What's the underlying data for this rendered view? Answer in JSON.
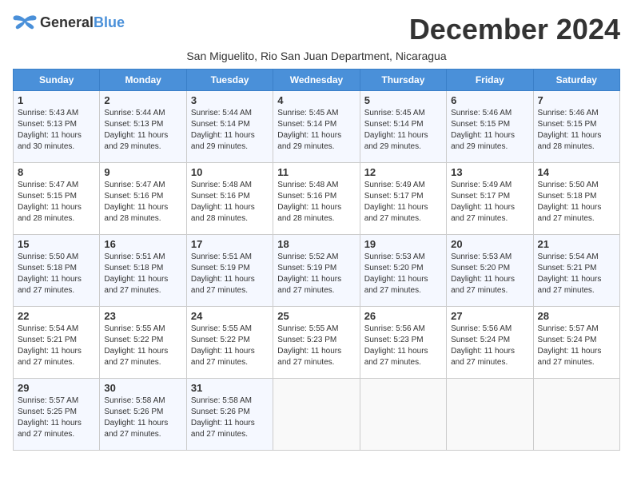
{
  "logo": {
    "general": "General",
    "blue": "Blue"
  },
  "title": "December 2024",
  "subtitle": "San Miguelito, Rio San Juan Department, Nicaragua",
  "days_of_week": [
    "Sunday",
    "Monday",
    "Tuesday",
    "Wednesday",
    "Thursday",
    "Friday",
    "Saturday"
  ],
  "weeks": [
    [
      {
        "day": "1",
        "info": "Sunrise: 5:43 AM\nSunset: 5:13 PM\nDaylight: 11 hours\nand 30 minutes."
      },
      {
        "day": "2",
        "info": "Sunrise: 5:44 AM\nSunset: 5:13 PM\nDaylight: 11 hours\nand 29 minutes."
      },
      {
        "day": "3",
        "info": "Sunrise: 5:44 AM\nSunset: 5:14 PM\nDaylight: 11 hours\nand 29 minutes."
      },
      {
        "day": "4",
        "info": "Sunrise: 5:45 AM\nSunset: 5:14 PM\nDaylight: 11 hours\nand 29 minutes."
      },
      {
        "day": "5",
        "info": "Sunrise: 5:45 AM\nSunset: 5:14 PM\nDaylight: 11 hours\nand 29 minutes."
      },
      {
        "day": "6",
        "info": "Sunrise: 5:46 AM\nSunset: 5:15 PM\nDaylight: 11 hours\nand 29 minutes."
      },
      {
        "day": "7",
        "info": "Sunrise: 5:46 AM\nSunset: 5:15 PM\nDaylight: 11 hours\nand 28 minutes."
      }
    ],
    [
      {
        "day": "8",
        "info": "Sunrise: 5:47 AM\nSunset: 5:15 PM\nDaylight: 11 hours\nand 28 minutes."
      },
      {
        "day": "9",
        "info": "Sunrise: 5:47 AM\nSunset: 5:16 PM\nDaylight: 11 hours\nand 28 minutes."
      },
      {
        "day": "10",
        "info": "Sunrise: 5:48 AM\nSunset: 5:16 PM\nDaylight: 11 hours\nand 28 minutes."
      },
      {
        "day": "11",
        "info": "Sunrise: 5:48 AM\nSunset: 5:16 PM\nDaylight: 11 hours\nand 28 minutes."
      },
      {
        "day": "12",
        "info": "Sunrise: 5:49 AM\nSunset: 5:17 PM\nDaylight: 11 hours\nand 27 minutes."
      },
      {
        "day": "13",
        "info": "Sunrise: 5:49 AM\nSunset: 5:17 PM\nDaylight: 11 hours\nand 27 minutes."
      },
      {
        "day": "14",
        "info": "Sunrise: 5:50 AM\nSunset: 5:18 PM\nDaylight: 11 hours\nand 27 minutes."
      }
    ],
    [
      {
        "day": "15",
        "info": "Sunrise: 5:50 AM\nSunset: 5:18 PM\nDaylight: 11 hours\nand 27 minutes."
      },
      {
        "day": "16",
        "info": "Sunrise: 5:51 AM\nSunset: 5:18 PM\nDaylight: 11 hours\nand 27 minutes."
      },
      {
        "day": "17",
        "info": "Sunrise: 5:51 AM\nSunset: 5:19 PM\nDaylight: 11 hours\nand 27 minutes."
      },
      {
        "day": "18",
        "info": "Sunrise: 5:52 AM\nSunset: 5:19 PM\nDaylight: 11 hours\nand 27 minutes."
      },
      {
        "day": "19",
        "info": "Sunrise: 5:53 AM\nSunset: 5:20 PM\nDaylight: 11 hours\nand 27 minutes."
      },
      {
        "day": "20",
        "info": "Sunrise: 5:53 AM\nSunset: 5:20 PM\nDaylight: 11 hours\nand 27 minutes."
      },
      {
        "day": "21",
        "info": "Sunrise: 5:54 AM\nSunset: 5:21 PM\nDaylight: 11 hours\nand 27 minutes."
      }
    ],
    [
      {
        "day": "22",
        "info": "Sunrise: 5:54 AM\nSunset: 5:21 PM\nDaylight: 11 hours\nand 27 minutes."
      },
      {
        "day": "23",
        "info": "Sunrise: 5:55 AM\nSunset: 5:22 PM\nDaylight: 11 hours\nand 27 minutes."
      },
      {
        "day": "24",
        "info": "Sunrise: 5:55 AM\nSunset: 5:22 PM\nDaylight: 11 hours\nand 27 minutes."
      },
      {
        "day": "25",
        "info": "Sunrise: 5:55 AM\nSunset: 5:23 PM\nDaylight: 11 hours\nand 27 minutes."
      },
      {
        "day": "26",
        "info": "Sunrise: 5:56 AM\nSunset: 5:23 PM\nDaylight: 11 hours\nand 27 minutes."
      },
      {
        "day": "27",
        "info": "Sunrise: 5:56 AM\nSunset: 5:24 PM\nDaylight: 11 hours\nand 27 minutes."
      },
      {
        "day": "28",
        "info": "Sunrise: 5:57 AM\nSunset: 5:24 PM\nDaylight: 11 hours\nand 27 minutes."
      }
    ],
    [
      {
        "day": "29",
        "info": "Sunrise: 5:57 AM\nSunset: 5:25 PM\nDaylight: 11 hours\nand 27 minutes."
      },
      {
        "day": "30",
        "info": "Sunrise: 5:58 AM\nSunset: 5:26 PM\nDaylight: 11 hours\nand 27 minutes."
      },
      {
        "day": "31",
        "info": "Sunrise: 5:58 AM\nSunset: 5:26 PM\nDaylight: 11 hours\nand 27 minutes."
      },
      {
        "day": "",
        "info": ""
      },
      {
        "day": "",
        "info": ""
      },
      {
        "day": "",
        "info": ""
      },
      {
        "day": "",
        "info": ""
      }
    ]
  ]
}
